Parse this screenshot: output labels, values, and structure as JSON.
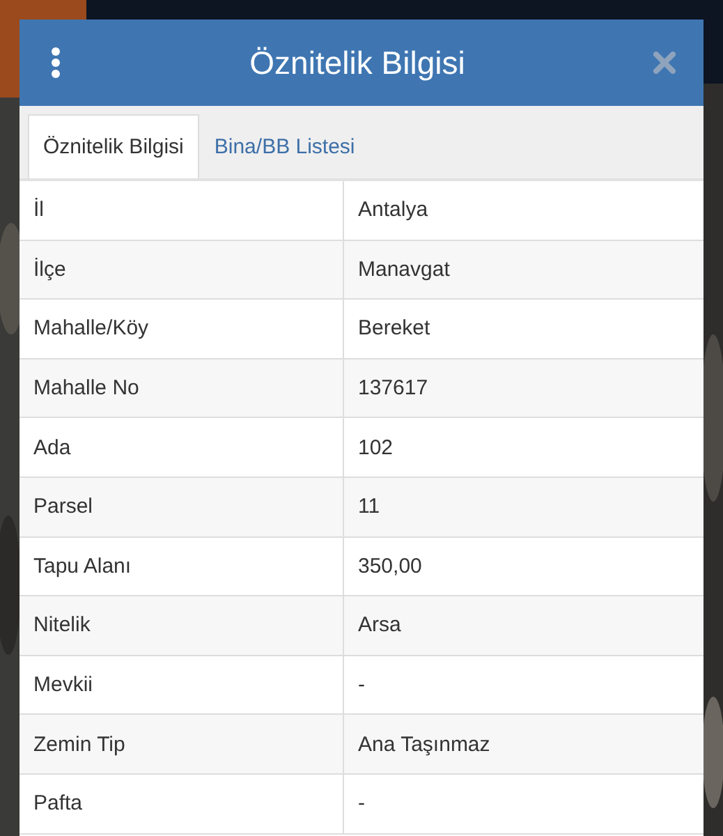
{
  "dialog": {
    "title": "Öznitelik Bilgisi"
  },
  "tabs": [
    {
      "label": "Öznitelik Bilgisi",
      "selected": true
    },
    {
      "label": "Bina/BB Listesi",
      "selected": false
    }
  ],
  "rows": [
    {
      "label": "İl",
      "value": "Antalya"
    },
    {
      "label": "İlçe",
      "value": "Manavgat"
    },
    {
      "label": "Mahalle/Köy",
      "value": "Bereket"
    },
    {
      "label": "Mahalle No",
      "value": "137617"
    },
    {
      "label": "Ada",
      "value": "102"
    },
    {
      "label": "Parsel",
      "value": "11"
    },
    {
      "label": "Tapu Alanı",
      "value": "350,00"
    },
    {
      "label": "Nitelik",
      "value": "Arsa"
    },
    {
      "label": "Mevkii",
      "value": "-"
    },
    {
      "label": "Zemin Tip",
      "value": "Ana Taşınmaz"
    },
    {
      "label": "Pafta",
      "value": "-"
    }
  ]
}
